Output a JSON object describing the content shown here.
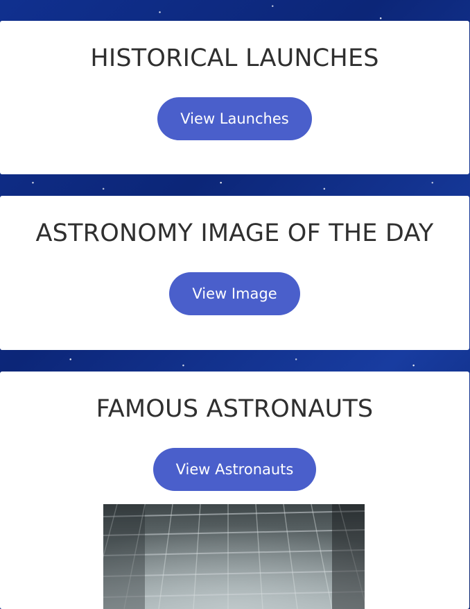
{
  "cards": [
    {
      "title": "HISTORICAL LAUNCHES",
      "button_label": "View Launches"
    },
    {
      "title": "ASTRONOMY IMAGE OF THE DAY",
      "button_label": "View Image"
    },
    {
      "title": "FAMOUS ASTRONAUTS",
      "button_label": "View Astronauts"
    }
  ],
  "colors": {
    "button_bg": "#4a5fcb",
    "button_text": "#ffffff",
    "title_text": "#2f2f2f",
    "card_bg": "#ffffff",
    "page_bg": "#0d2a8a"
  }
}
